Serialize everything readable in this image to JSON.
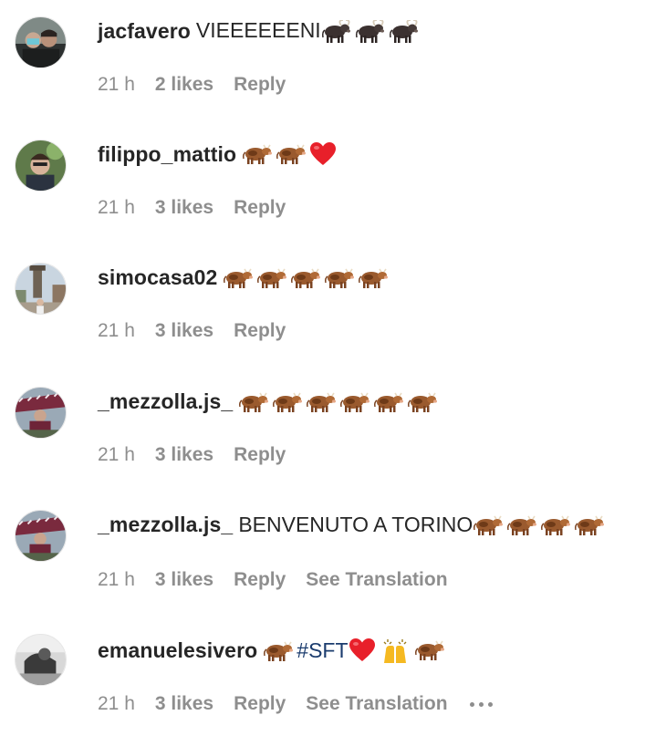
{
  "comments": [
    {
      "username": "jacfavero",
      "text": "VIEEEEEENI",
      "emojis": [
        "ox",
        "ox",
        "ox"
      ],
      "time": "21 h",
      "likes": "2 likes",
      "reply": "Reply"
    },
    {
      "username": "filippo_mattio",
      "text": "",
      "emojis": [
        "cow",
        "cow",
        "heart"
      ],
      "time": "21 h",
      "likes": "3 likes",
      "reply": "Reply"
    },
    {
      "username": "simocasa02",
      "text": "",
      "emojis": [
        "cow",
        "cow",
        "cow",
        "cow",
        "cow"
      ],
      "time": "21 h",
      "likes": "3 likes",
      "reply": "Reply"
    },
    {
      "username": "_mezzolla.js_",
      "text": "",
      "emojis": [
        "cow",
        "cow",
        "cow",
        "cow",
        "cow",
        "cow"
      ],
      "time": "21 h",
      "likes": "3 likes",
      "reply": "Reply"
    },
    {
      "username": "_mezzolla.js_",
      "text": "BENVENUTO A TORINO",
      "emojis": [
        "cow",
        "cow",
        "cow",
        "cow"
      ],
      "time": "21 h",
      "likes": "3 likes",
      "reply": "Reply",
      "translate": "See Translation"
    },
    {
      "username": "emanuelesivero",
      "text": "",
      "hashtag": "#SFT",
      "emojis_before": [
        "cow"
      ],
      "emojis": [
        "heart",
        "raised-hands",
        "cow"
      ],
      "time": "21 h",
      "likes": "3 likes",
      "reply": "Reply",
      "translate": "See Translation",
      "more": "more-options-icon"
    }
  ],
  "colors": {
    "username": "#262626",
    "meta": "#8e8e8e",
    "hashtag": "#1b3c6e",
    "heart": "#e8202a"
  }
}
